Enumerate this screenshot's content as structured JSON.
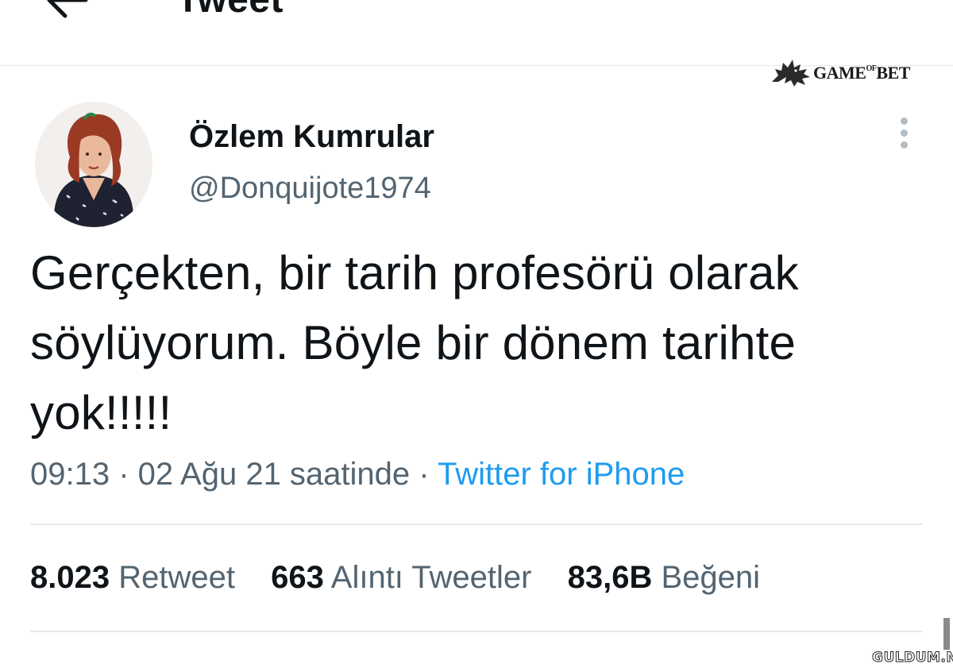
{
  "header": {
    "title": "Tweet",
    "back_icon": "arrow-left-icon"
  },
  "watermark_top": {
    "brand_main": "GAME",
    "brand_small": "OF",
    "brand_end": "BET",
    "icon": "wolf-head-icon"
  },
  "tweet": {
    "display_name": "Özlem Kumrular",
    "handle": "@Donquijote1974",
    "more_icon": "more-vertical-icon",
    "text_lines": [
      "Gerçekten, bir tarih profesörü olarak",
      "söylüyorum. Böyle bir dönem tarihte",
      "yok!!!!!"
    ],
    "timestamp": "09:13 · 02 Ağu 21 saatinde",
    "separator": " · ",
    "source": "Twitter for iPhone"
  },
  "stats": [
    {
      "value": "8.023",
      "label": "Retweet"
    },
    {
      "value": "663",
      "label": "Alıntı Tweetler"
    },
    {
      "value": "83,6B",
      "label": "Beğeni"
    }
  ],
  "watermark_bottom": "GULDUM.NET",
  "colors": {
    "text_primary": "#0f1419",
    "text_secondary": "#536471",
    "link": "#1d9bf0",
    "divider": "#e6e9eb"
  }
}
